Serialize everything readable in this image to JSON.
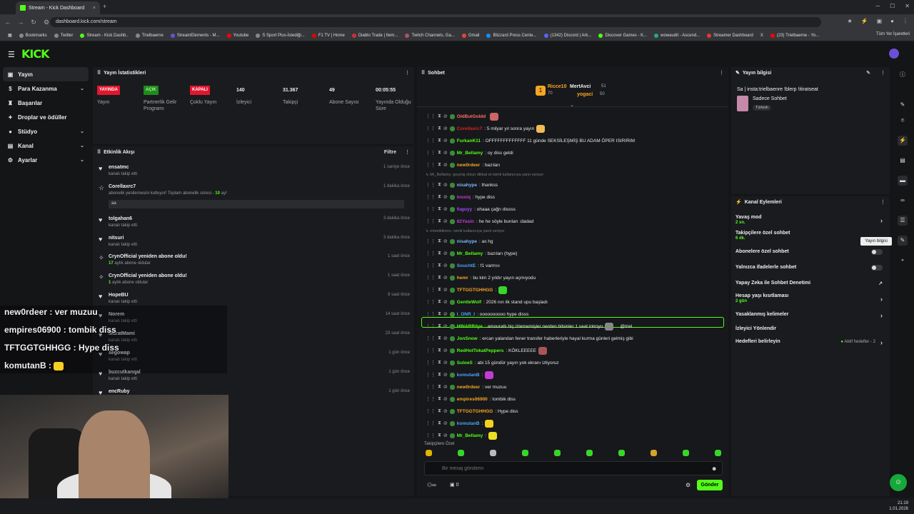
{
  "browser": {
    "tab_title": "Stream - Kick Dashboard",
    "url": "dashboard.kick.com/stream",
    "bookmarks": [
      "Bookmarks",
      "Twitter",
      "Stream - Kick Dashb..",
      "Trielbaerne",
      "StreamElements - M...",
      "Youtube",
      "S Sport Plus-İstediği...",
      "F1 TV | Home",
      "Diablo Trade | Item...",
      "Twitch Channels, Ga...",
      "Gmail",
      "Blizzard Press Cente...",
      "(1342) Discord | Ark...",
      "Discover Games - K...",
      "wowaudit - Ascend...",
      "Streamer Dashboard",
      "X",
      "(23) Trielbaerne - Yo..."
    ],
    "bookmarks_all": "Tüm Yer İşaretleri"
  },
  "brand": "KICK",
  "sidebar": [
    {
      "label": "Yayın",
      "icon": "broadcast-icon"
    },
    {
      "label": "Para Kazanma",
      "icon": "dollar-icon"
    },
    {
      "label": "Başarılar",
      "icon": "trophy-icon"
    },
    {
      "label": "Droplar ve ödüller",
      "icon": "gift-icon"
    },
    {
      "label": "Stüdyo",
      "icon": "studio-icon"
    },
    {
      "label": "Kanal",
      "icon": "channel-icon"
    },
    {
      "label": "Ayarlar",
      "icon": "settings-icon"
    }
  ],
  "stats": {
    "title": "Yayın İstatistikleri",
    "items": [
      {
        "value": "YAYINDA",
        "label": "Yayın"
      },
      {
        "value": "AÇIK",
        "label": "Partnerlik Gelir Programı"
      },
      {
        "value": "KAPALI",
        "label": "Çoklu Yayın"
      },
      {
        "value": "140",
        "label": "İzleyici"
      },
      {
        "value": "31.367",
        "label": "Takipçi"
      },
      {
        "value": "49",
        "label": "Abone Sayısı"
      },
      {
        "value": "00:05:55",
        "label": "Yayında Olduğu Süre"
      }
    ]
  },
  "activity": {
    "title": "Etkinlik Akışı",
    "filter": "Filtre",
    "message": "aa",
    "items": [
      {
        "name": "ensatmc",
        "sub": "kanalı takip etti",
        "time": "1 saniye önce"
      },
      {
        "name": "Corellaxrc7",
        "sub": "abonelik yenilemesini kutluyor! Toplam abonelik süresi - ",
        "hl": "10",
        "sub2": " ay!",
        "time": "1 dakika önce"
      },
      {
        "name": "tolgahan6",
        "sub": "kanalı takip etti",
        "time": "3 dakika önce"
      },
      {
        "name": "nitsuri",
        "sub": "kanalı takip etti",
        "time": "3 dakika önce"
      },
      {
        "name": "CrynOfficial yeniden abone oldu!",
        "hl": "17",
        "sub": " aylık abone oldular",
        "time": "1 saat önce"
      },
      {
        "name": "CrynOfficial yeniden abone oldu!",
        "hl": "1",
        "sub": " aylık abone oldular",
        "time": "1 saat önce"
      },
      {
        "name": "HopeBU",
        "sub": "kanalı takip etti",
        "time": "8 saat önce"
      },
      {
        "name": "Norem",
        "sub": "kanalı takip etti",
        "time": "14 saat önce"
      },
      {
        "name": "MuratMami",
        "sub": "kanalı takip etti",
        "time": "23 saat önce"
      },
      {
        "name": "segowap",
        "sub": "kanalı takip etti",
        "time": "1 gün önce"
      },
      {
        "name": "buzcutkanqal",
        "sub": "kanalı takip etti",
        "time": "1 gün önce"
      },
      {
        "name": "encRuby",
        "sub": "",
        "time": "1 gün önce"
      }
    ]
  },
  "overlay": [
    "new0rdeer : ver muzuu",
    "empires06900 : tombik diss",
    "TFTGGTGHHGG : Hype diss",
    "komutanB :"
  ],
  "chat": {
    "title": "Sohbet",
    "pinned": [
      {
        "name": "Ricce10",
        "count": "70"
      },
      {
        "name": "MertAvci",
        "count": "51"
      },
      {
        "name": "yogaci",
        "count": "50"
      }
    ],
    "messages": [
      {
        "u": "OldButGoldd",
        "c": "#ff6a6a",
        "m": ""
      },
      {
        "u": "Corellaxrc7",
        "c": "#d22",
        "m": ": 5 milyar yıl sonra yayın"
      },
      {
        "u": "FurkanK11",
        "c": "#53fc18",
        "m": ": OFFFFFFFFFFFFF 11 günde SEKSİLEŞMİŞ BU ADAM ÖPER ISIRIRIM"
      },
      {
        "u": "Mr_Bellamy",
        "c": "#53fc18",
        "m": ": oy diss geldi"
      },
      {
        "u": "new0rdeer",
        "c": "#f5a623",
        "m": ": bazıları"
      },
      {
        "sys": "↳ Mr_Bellamy: geçmiş olsun dikkat et isimli kullanıcıya yanıt veriyor"
      },
      {
        "u": "nisahype",
        "c": "#7ab8ff",
        "m": ": thankss"
      },
      {
        "u": "Inoxiq",
        "c": "#c43ad6",
        "m": ": hype diss"
      },
      {
        "u": "fuguyy",
        "c": "#a14bff",
        "m": ": ohaaa çağrı dissss"
      },
      {
        "u": "82Yasin",
        "c": "#c43ad6",
        "m": ": he he söyle bunları :dadad"
      },
      {
        "sys": "↳ mhmtktkmrc: isimli kullanıcıya yanıt veriyor"
      },
      {
        "u": "nisahype",
        "c": "#7ab8ff",
        "m": ": as hg"
      },
      {
        "u": "Mr_Bellamy",
        "c": "#53fc18",
        "m": ": bazıları (hype)"
      },
      {
        "u": "SouchtE",
        "c": "#4aa3ff",
        "m": ": f1 varmııı"
      },
      {
        "u": "hemr",
        "c": "#f5a623",
        "m": ": bu kim 2 yıldır yayın açmıyodu"
      },
      {
        "u": "TFTGGTGHHGG",
        "c": "#f5a623",
        "m": ":"
      },
      {
        "u": "GentleWolf",
        "c": "#53fc18",
        "m": ": 2026 nın ilk stand upu başladı"
      },
      {
        "u": "I_ONR_I",
        "c": "#4aa3ff",
        "m": ": oooooooooo hype disss"
      },
      {
        "u": "HINARRiiye",
        "c": "#53fc18",
        "m": ": amouratlı hiç izlememişler nerden bilsinler 1 saat introyu",
        "extra": "@triel"
      },
      {
        "u": "JonSnow",
        "c": "#53fc18",
        "m": ": ercan yalandan fener transfer haberleriyle hayal kurma günleri gelmiş gibi"
      },
      {
        "u": "RedHotTokatPeppers",
        "c": "#53fc18",
        "m": ": KÖKLEEEEE"
      },
      {
        "u": "SuloeS",
        "c": "#53fc18",
        "m": ": abi 15 gündür yayın yok ekranı izliyoruz"
      },
      {
        "u": "komutanB",
        "c": "#4aa3ff",
        "m": ":"
      },
      {
        "u": "new0rdeer",
        "c": "#f5a623",
        "m": ": ver muzuu"
      },
      {
        "u": "empires06900",
        "c": "#f5a623",
        "m": ": tombik diss"
      },
      {
        "u": "TFTGGTGHHGG",
        "c": "#f5a623",
        "m": ": Hype diss"
      },
      {
        "u": "komutanB",
        "c": "#4aa3ff",
        "m": ":"
      },
      {
        "u": "Mr_Bellamy",
        "c": "#53fc18",
        "m": ":"
      }
    ],
    "followers_only": "Takipçilere Özel",
    "placeholder": "Bir mesaj gönderin",
    "send": "Gönder",
    "count": "0"
  },
  "stream_info": {
    "title": "Yayın bilgisi",
    "stream_title": "Sa | insta:trielbaenre !blerp !itiratseat",
    "category": "Sadece Sohbet",
    "tag": "Türkish"
  },
  "channel_actions": {
    "title": "Kanal Eylemleri",
    "items": [
      {
        "label": "Yavaş mod",
        "sub": "2 sn.",
        "ctrl": "arrow"
      },
      {
        "label": "Takipçilere özel sohbet",
        "sub": "6 dk.",
        "ctrl": "arrow"
      },
      {
        "label": "Abonelere özel sohbet",
        "sub": "",
        "ctrl": "toggle"
      },
      {
        "label": "Yalnızca ifadelerle sohbet",
        "sub": "",
        "ctrl": "toggle"
      },
      {
        "label": "Yapay Zeka ile Sohbet Denetimi",
        "sub": "",
        "ctrl": "ext"
      },
      {
        "label": "Hesap yaşı kısıtlaması",
        "sub": "2 gün",
        "ctrl": "arrow"
      },
      {
        "label": "Yasaklanmış kelimeler",
        "sub": "",
        "ctrl": "arrow"
      },
      {
        "label": "İzleyici Yönlendir",
        "sub": "",
        "ctrl": "none"
      },
      {
        "label": "Hedefleri belirleyin",
        "sub": "",
        "ctrl": "goal",
        "goal": "Aktif hedefler - 2"
      }
    ]
  },
  "tooltip": "Yayın bilgisi",
  "clock": {
    "time": "21:19",
    "date": "1.01.2026"
  },
  "colors": {
    "accent": "#53fc18",
    "live": "#e0172f"
  }
}
